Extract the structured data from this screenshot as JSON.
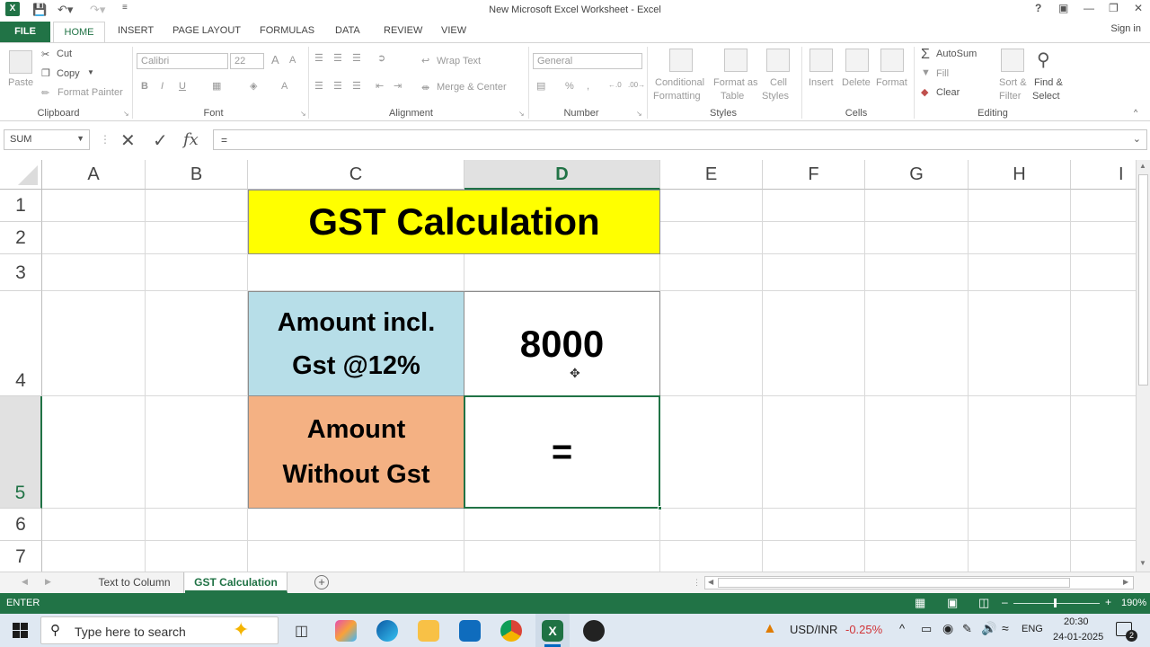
{
  "window": {
    "title": "New Microsoft Excel Worksheet - Excel",
    "help": "?",
    "sign_in": "Sign in"
  },
  "tabs": [
    "FILE",
    "HOME",
    "INSERT",
    "PAGE LAYOUT",
    "FORMULAS",
    "DATA",
    "REVIEW",
    "VIEW"
  ],
  "ribbon": {
    "clipboard": {
      "name": "Clipboard",
      "paste": "Paste",
      "cut": "Cut",
      "copy": "Copy",
      "format_painter": "Format Painter"
    },
    "font": {
      "name": "Font",
      "font_name": "Calibri",
      "font_size": "22",
      "bold": "B",
      "italic": "I",
      "underline": "U",
      "grow": "A",
      "shrink": "A"
    },
    "alignment": {
      "name": "Alignment",
      "wrap_text": "Wrap Text",
      "merge_center": "Merge & Center"
    },
    "number": {
      "name": "Number",
      "format": "General",
      "percent": "%",
      "comma": ","
    },
    "styles": {
      "name": "Styles",
      "conditional_1": "Conditional",
      "conditional_2": "Formatting",
      "format_as_1": "Format as",
      "format_as_2": "Table",
      "cell_styles_1": "Cell",
      "cell_styles_2": "Styles"
    },
    "cells": {
      "name": "Cells",
      "insert": "Insert",
      "delete": "Delete",
      "format": "Format"
    },
    "editing": {
      "name": "Editing",
      "autosum": "AutoSum",
      "fill": "Fill",
      "clear": "Clear",
      "sort_1": "Sort &",
      "sort_2": "Filter",
      "find_1": "Find &",
      "find_2": "Select"
    }
  },
  "formula_bar": {
    "name_box": "SUM",
    "fx": "fx",
    "content": "="
  },
  "columns": [
    "A",
    "B",
    "C",
    "D",
    "E",
    "F",
    "G",
    "H",
    "I"
  ],
  "rows": [
    "1",
    "2",
    "3",
    "4",
    "5",
    "6",
    "7"
  ],
  "cells": {
    "title": "GST Calculation",
    "amount_incl_1": "Amount incl.",
    "amount_incl_2": "Gst @12%",
    "amount_value": "8000",
    "amount_without_1": "Amount",
    "amount_without_2": "Without Gst",
    "editing_value": "="
  },
  "colors": {
    "excel_green": "#217346",
    "title_fill": "#ffff00",
    "incl_fill": "#b7dee8",
    "without_fill": "#f4b183"
  },
  "sheets": [
    "Text to Column",
    "GST Calculation"
  ],
  "active_sheet": "GST Calculation",
  "status": {
    "mode": "ENTER",
    "zoom": "190%"
  },
  "taskbar": {
    "search_placeholder": "Type here to search",
    "ticker": "USD/INR",
    "ticker_change": "-0.25%",
    "language": "ENG",
    "time": "20:30",
    "date": "24-01-2025",
    "notification_count": "2"
  }
}
